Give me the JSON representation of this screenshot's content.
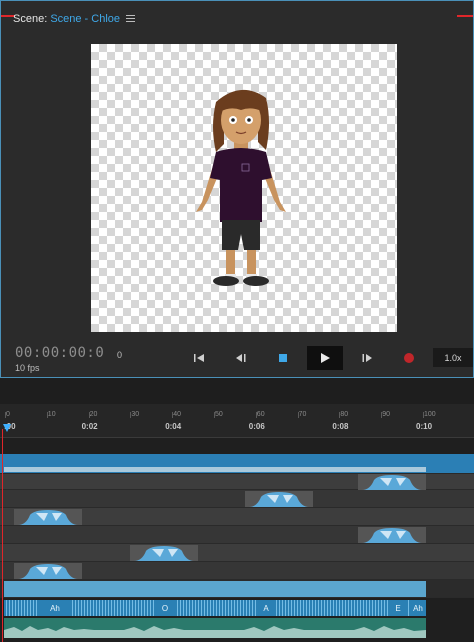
{
  "scene": {
    "label": "Scene:",
    "name": "Scene - Chloe"
  },
  "transport": {
    "timecode": "00:00:00:0",
    "fps": "10 fps",
    "frame": "0",
    "speed": "1.0x"
  },
  "timeline": {
    "frame_ticks": [
      "0",
      "10",
      "20",
      "30",
      "40",
      "50",
      "60",
      "70",
      "80",
      "90",
      "100"
    ],
    "time_labels": [
      ":00",
      "0:02",
      "0:04",
      "0:06",
      "0:08",
      "0:10"
    ],
    "visemes": [
      "Ah",
      "O",
      "A",
      "E",
      "Ah"
    ]
  },
  "colors": {
    "accent": "#3fa8e8",
    "record": "#c0262a",
    "shirt": "#2e0f2e",
    "skin": "#c8935e"
  }
}
